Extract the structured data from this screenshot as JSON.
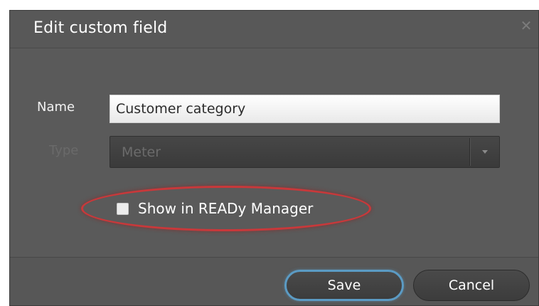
{
  "dialog": {
    "title": "Edit custom field",
    "close_glyph": "✕"
  },
  "form": {
    "name_label": "Name",
    "name_value": "Customer category",
    "type_label": "Type",
    "type_value": "Meter",
    "type_disabled": true,
    "show_checkbox_label": "Show in READy Manager",
    "show_checkbox_checked": false
  },
  "footer": {
    "save_label": "Save",
    "cancel_label": "Cancel"
  },
  "colors": {
    "dialog_bg": "#5a5a5a",
    "highlight_ring": "#c9383a",
    "save_focus_ring": "#5b9bc4"
  },
  "icons": {
    "close": "close-icon",
    "dropdown": "chevron-down-icon"
  }
}
